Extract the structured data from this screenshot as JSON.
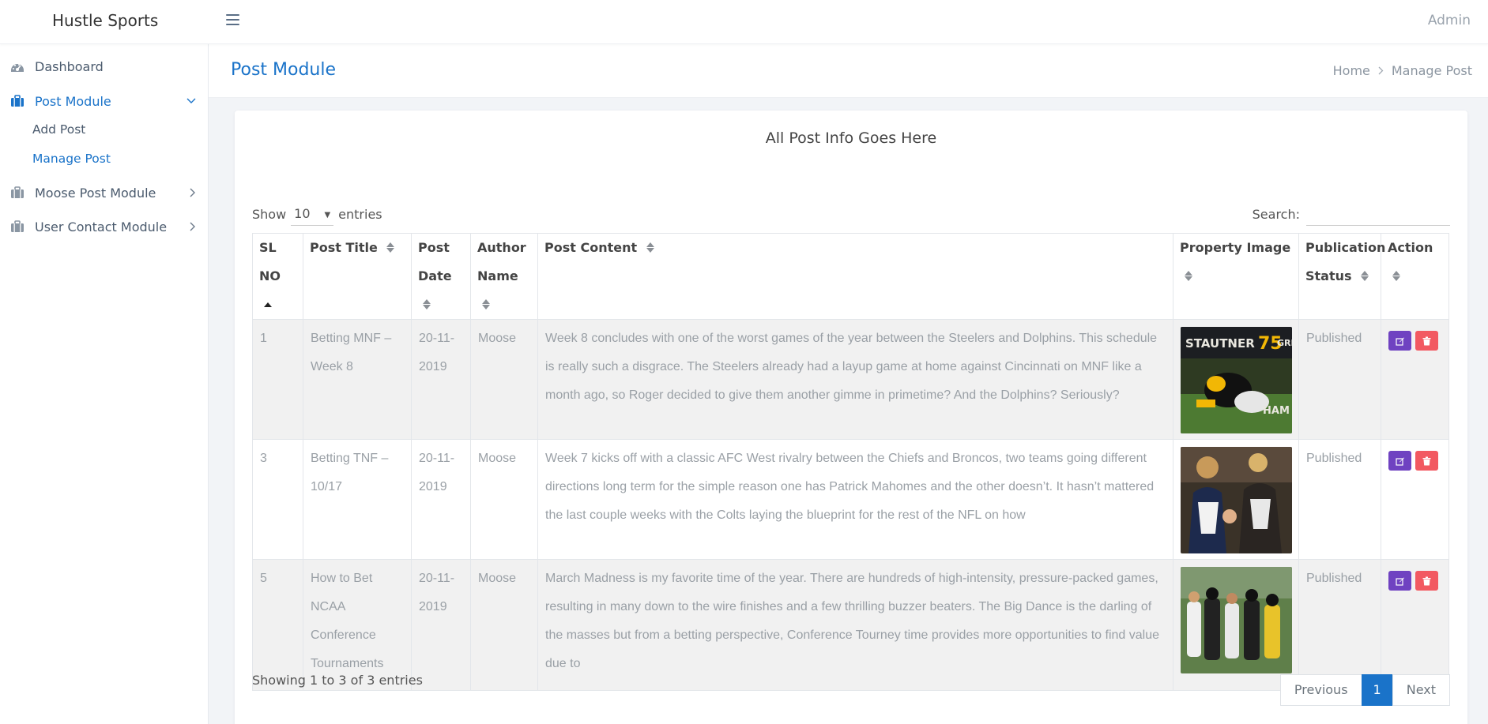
{
  "app": {
    "brand": "Hustle Sports",
    "user": "Admin"
  },
  "sidebar": {
    "items": [
      {
        "label": "Dashboard",
        "icon": "dashboard-icon"
      },
      {
        "label": "Post Module",
        "icon": "briefcase-icon",
        "expanded": true,
        "children": [
          {
            "label": "Add Post"
          },
          {
            "label": "Manage Post",
            "active": true
          }
        ]
      },
      {
        "label": "Moose Post Module",
        "icon": "briefcase-icon"
      },
      {
        "label": "User Contact Module",
        "icon": "briefcase-icon"
      }
    ]
  },
  "header": {
    "title": "Post Module",
    "breadcrumb": [
      "Home",
      "Manage Post"
    ]
  },
  "card": {
    "title": "All Post Info Goes Here"
  },
  "controls": {
    "show_label": "Show",
    "entries_value": "10",
    "entries_label": "entries",
    "search_label": "Search:",
    "search_value": ""
  },
  "table": {
    "columns": [
      {
        "line1": "SL",
        "line2": "NO",
        "sort": "asc"
      },
      {
        "line1": "Post Title",
        "line2": "",
        "sort": "both"
      },
      {
        "line1": "Post",
        "line2": "Date",
        "sort": "both"
      },
      {
        "line1": "Author",
        "line2": "Name",
        "sort": "both"
      },
      {
        "line1": "Post Content",
        "line2": "",
        "sort": "both"
      },
      {
        "line1": "Property Image",
        "line2": "",
        "sort": "both"
      },
      {
        "line1": "Publication",
        "line2": "Status",
        "sort": "both"
      },
      {
        "line1": "Action",
        "line2": "",
        "sort": "both"
      }
    ],
    "rows": [
      {
        "sl": "1",
        "title": "Betting MNF – Week 8",
        "date": "20-11-2019",
        "author": "Moose",
        "content": "Week 8 concludes with one of the worst games of the year between the Steelers and Dolphins. This schedule is really such a disgrace. The Steelers already had a layup game at home against Cincinnati on MNF like a month ago, so Roger decided to give them another gimme in primetime? And the Dolphins? Seriously?",
        "status": "Published",
        "image": "football-tackle-photo"
      },
      {
        "sl": "3",
        "title": "Betting TNF – 10/17",
        "date": "20-11-2019",
        "author": "Moose",
        "content": "Week 7 kicks off with a classic AFC West rivalry between the Chiefs and Broncos, two teams going different directions long term for the simple reason one has Patrick Mahomes and the other doesn’t. It hasn’t mattered the last couple weeks with the Colts laying the blueprint for the rest of the NFL on how",
        "status": "Published",
        "image": "fans-cheering-photo"
      },
      {
        "sl": "5",
        "title": "How to Bet NCAA Conference Tournaments",
        "date": "20-11-2019",
        "author": "Moose",
        "content": "March Madness is my favorite time of the year. There are hundreds of high-intensity, pressure-packed games, resulting in many down to the wire finishes and a few thrilling buzzer beaters. The Big Dance is the darling of the masses but from a betting perspective, Conference Tourney time provides more opportunities to find value due to",
        "status": "Published",
        "image": "football-practice-photo"
      }
    ]
  },
  "footer": {
    "info": "Showing 1 to 3 of 3 entries",
    "prev": "Previous",
    "page": "1",
    "next": "Next"
  },
  "colors": {
    "accent": "#1a73c9",
    "edit": "#6f42c1",
    "delete": "#f25961"
  }
}
